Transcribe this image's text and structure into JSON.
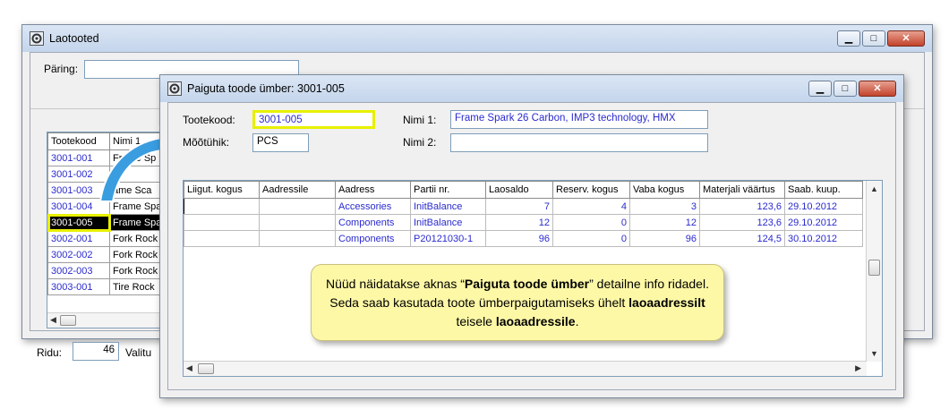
{
  "back_window": {
    "title": "Laotooted",
    "query_label": "Päring:",
    "columns": [
      "Tootekood",
      "Nimi 1"
    ],
    "rows": [
      {
        "code": "3001-001",
        "name": "Frame Sp"
      },
      {
        "code": "3001-002",
        "name": "F"
      },
      {
        "code": "3001-003",
        "name": "ame Sca"
      },
      {
        "code": "3001-004",
        "name": "Frame Spa"
      },
      {
        "code": "3001-005",
        "name": "Frame Spa"
      },
      {
        "code": "3002-001",
        "name": "Fork Rock"
      },
      {
        "code": "3002-002",
        "name": "Fork Rock"
      },
      {
        "code": "3002-003",
        "name": "Fork Rock"
      },
      {
        "code": "3003-001",
        "name": "Tire Rock"
      }
    ],
    "selected_row": 4,
    "rows_label": "Ridu:",
    "rows_count": "46",
    "selected_label": "Valitu"
  },
  "dialog": {
    "title": "Paiguta toode ümber: 3001-005",
    "product_code_label": "Tootekood:",
    "product_code_value": "3001-005",
    "unit_label": "Mõõtühik:",
    "unit_value": "PCS",
    "name1_label": "Nimi 1:",
    "name1_value": "Frame Spark 26 Carbon, IMP3 technology, HMX",
    "name2_label": "Nimi 2:",
    "name2_value": "",
    "columns": [
      "Liigut. kogus",
      "Aadressile",
      "Aadress",
      "Partii nr.",
      "Laosaldo",
      "Reserv. kogus",
      "Vaba kogus",
      "Materjali väärtus",
      "Saab. kuup."
    ],
    "rows": [
      {
        "qty": "",
        "to": "",
        "address": "Accessories",
        "batch": "InitBalance",
        "balance": "7",
        "reserved": "4",
        "free": "3",
        "value": "123,6",
        "date": "29.10.2012"
      },
      {
        "qty": "",
        "to": "",
        "address": "Components",
        "batch": "InitBalance",
        "balance": "12",
        "reserved": "0",
        "free": "12",
        "value": "123,6",
        "date": "29.10.2012"
      },
      {
        "qty": "",
        "to": "",
        "address": "Components",
        "batch": "P20121030-1",
        "balance": "96",
        "reserved": "0",
        "free": "96",
        "value": "124,5",
        "date": "30.10.2012"
      }
    ]
  },
  "note": {
    "p1": "Nüüd näidatakse aknas “",
    "b1": "Paiguta toode ümber",
    "p2": "” detailne info ridadel. Seda saab kasutada toote ümberpaigutamiseks ühelt ",
    "b2": "laoaadressilt",
    "p3": "  teisele ",
    "b3": "laoaadressile",
    "p4": "."
  },
  "colors": {
    "highlight": "#e8f000",
    "arrow": "#3a9de0",
    "link_text": "#2a2ad0"
  }
}
